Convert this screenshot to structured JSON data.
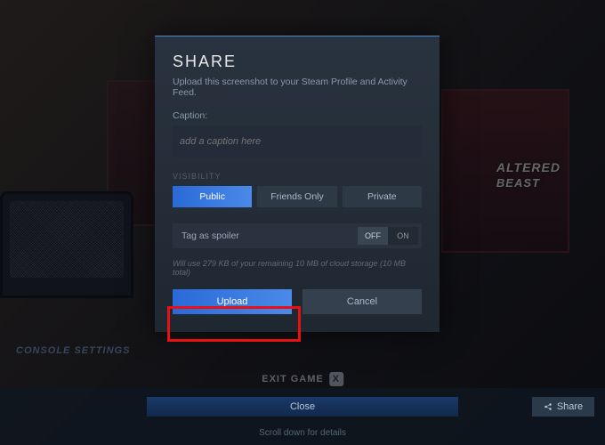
{
  "background": {
    "poster_line1": "ALTERED",
    "poster_line2": "BEAST",
    "console_settings": "CONSOLE SETTINGS",
    "exit_game": "EXIT GAME",
    "exit_key": "X"
  },
  "bottom": {
    "close": "Close",
    "share": "Share",
    "scroll_hint": "Scroll down for details"
  },
  "dialog": {
    "title": "SHARE",
    "subtitle": "Upload this screenshot to your Steam Profile and Activity Feed.",
    "caption_label": "Caption:",
    "caption_placeholder": "add a caption here",
    "visibility_label": "VISIBILITY",
    "visibility": {
      "public": "Public",
      "friends": "Friends Only",
      "private": "Private"
    },
    "spoiler_label": "Tag as spoiler",
    "toggle": {
      "off": "OFF",
      "on": "ON"
    },
    "storage": "Will use 279 KB of your remaining 10 MB of cloud storage (10 MB total)",
    "upload": "Upload",
    "cancel": "Cancel"
  }
}
